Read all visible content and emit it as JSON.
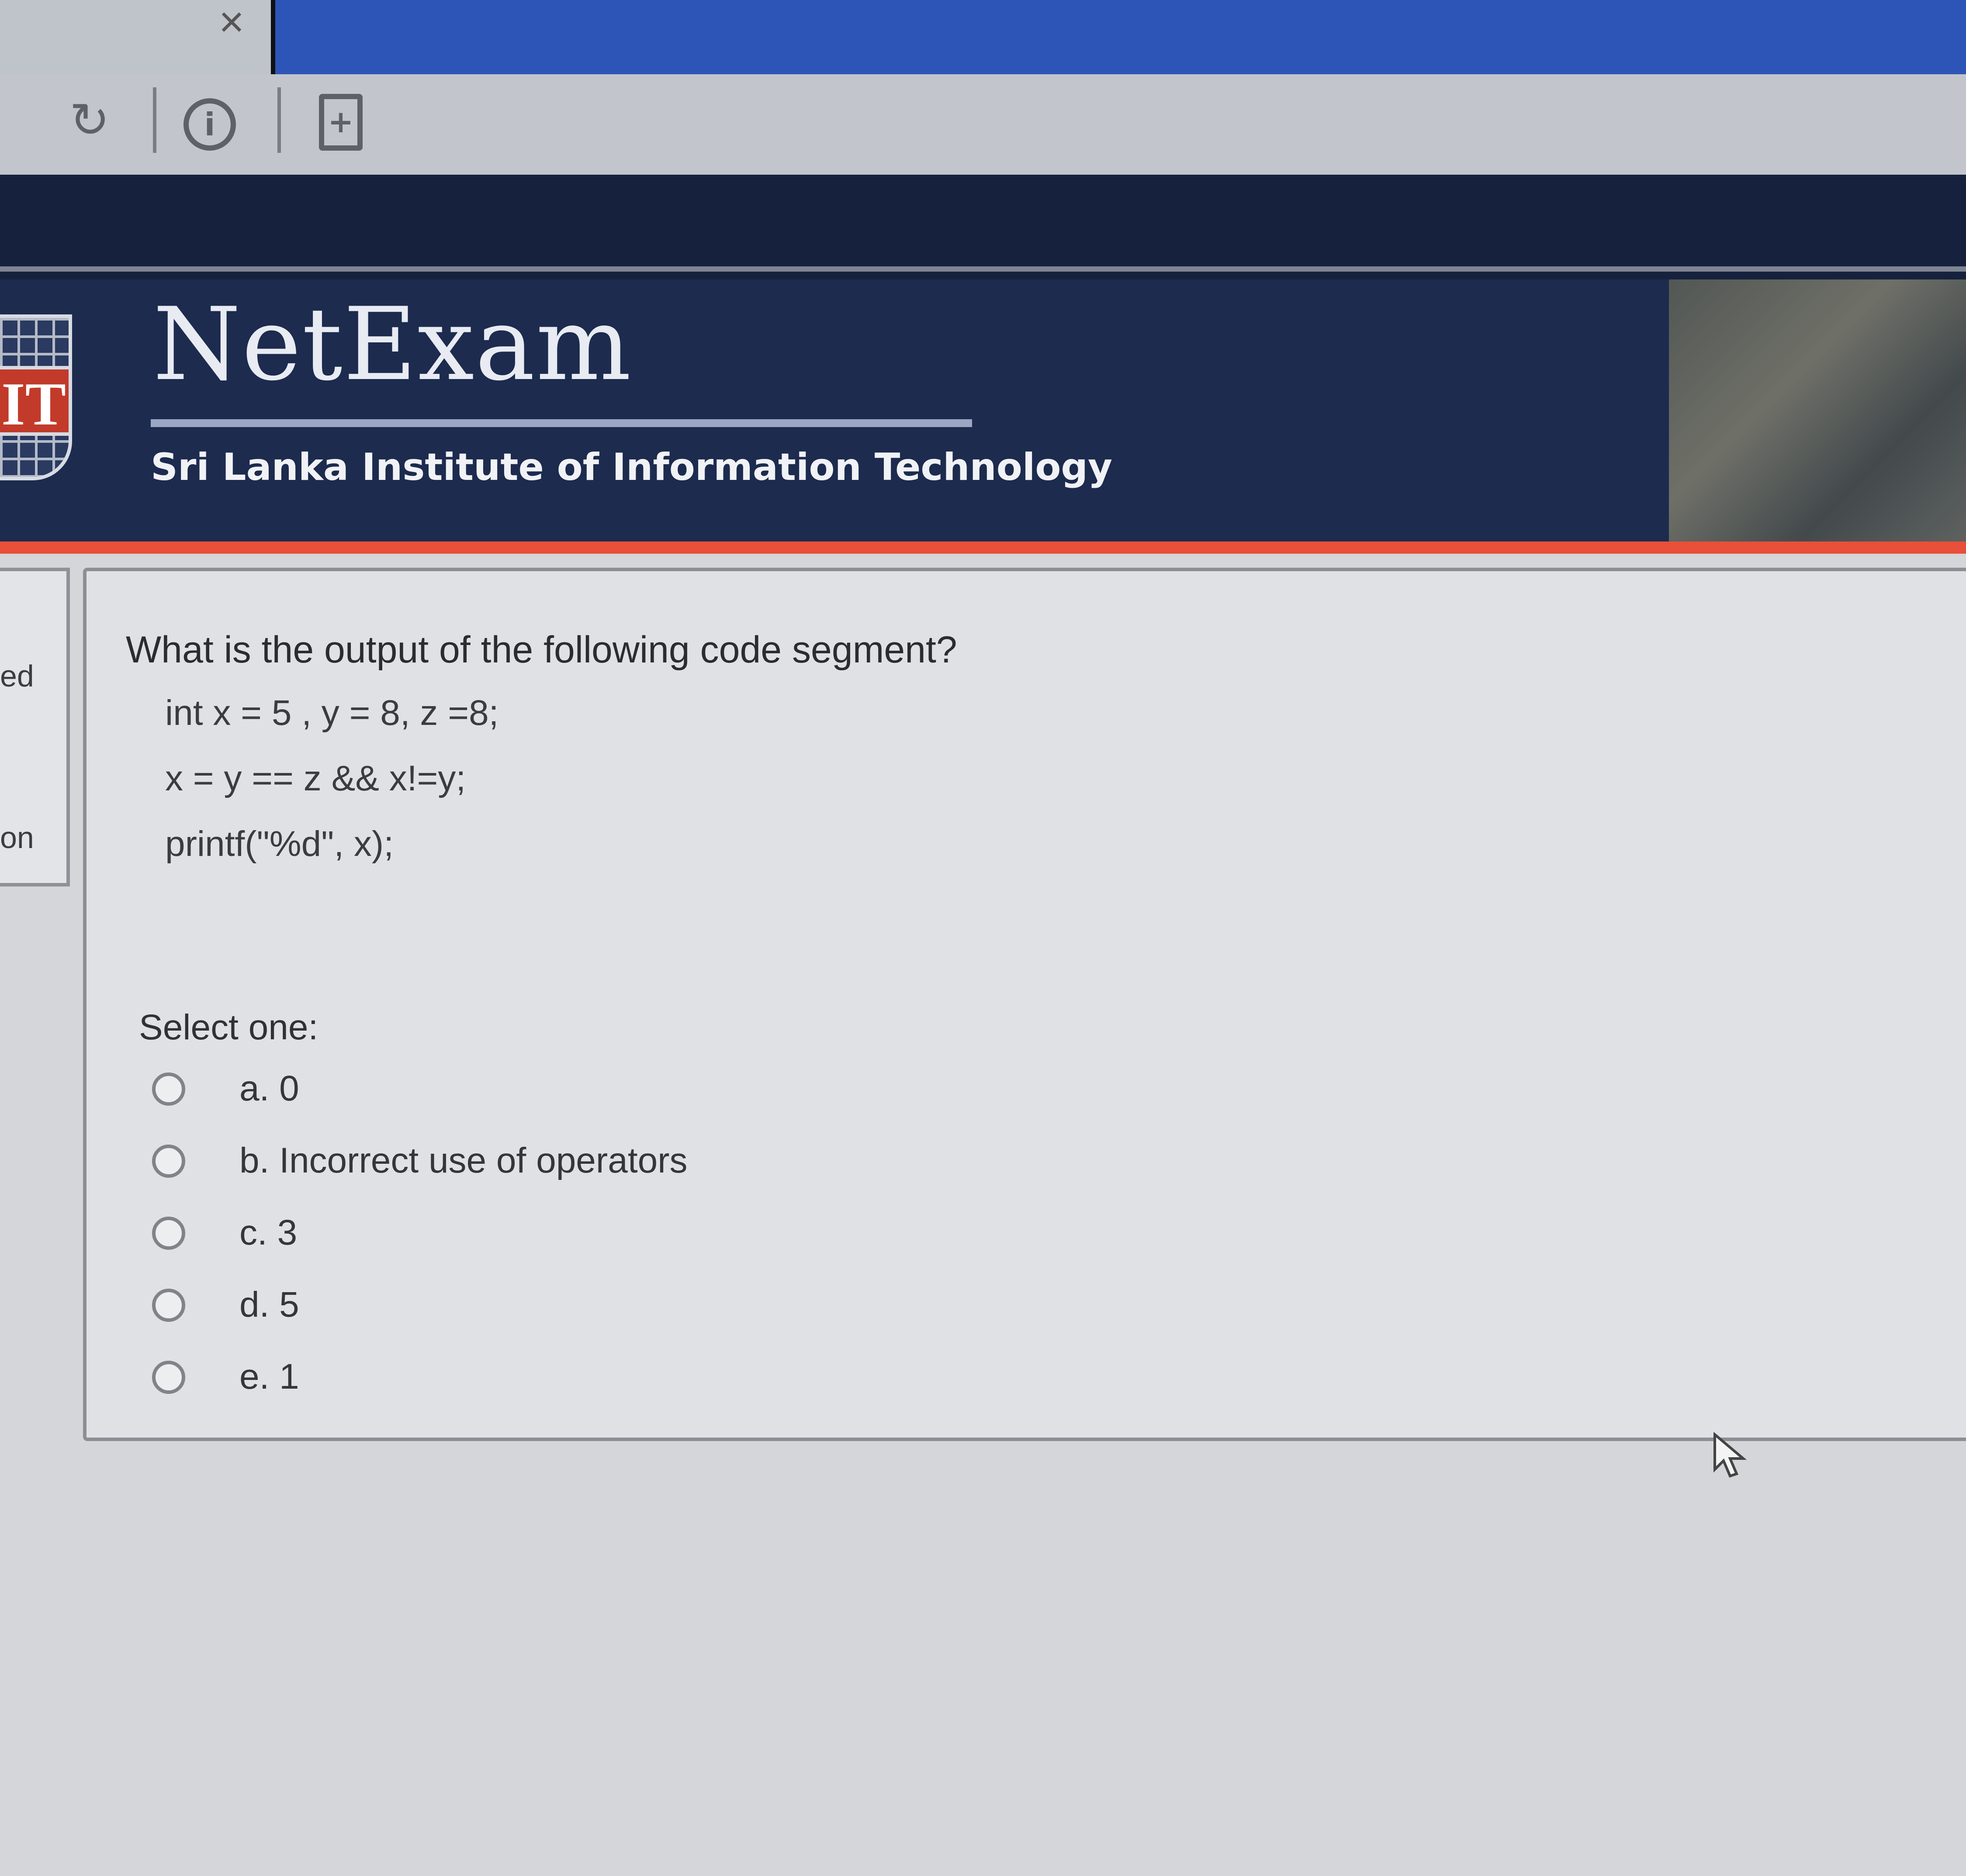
{
  "browser": {
    "tab_close": "×",
    "toolbar": {
      "refresh_icon": "refresh-icon",
      "info_icon": "info-icon",
      "page_icon": "page-icon"
    }
  },
  "header": {
    "brand": "NetExam",
    "institute": "Sri Lanka Institute of Information Technology",
    "logo_text": "IT",
    "colors": {
      "header_bg": "#1c2b4e",
      "accent_bar": "#e8503a",
      "logo_red": "#c23a2a"
    }
  },
  "side_panel": {
    "label_top": "ed",
    "label_bottom": "on"
  },
  "question": {
    "prompt": "What is the output of the following code segment?",
    "code": [
      "int x = 5 , y = 8, z =8;",
      "x = y == z && x!=y;",
      "printf(\"%d\", x);"
    ],
    "select_label": "Select one:",
    "options": [
      {
        "label": "a. 0"
      },
      {
        "label": "b. Incorrect use of operators"
      },
      {
        "label": "c. 3"
      },
      {
        "label": "d. 5"
      },
      {
        "label": "e. 1"
      }
    ]
  }
}
